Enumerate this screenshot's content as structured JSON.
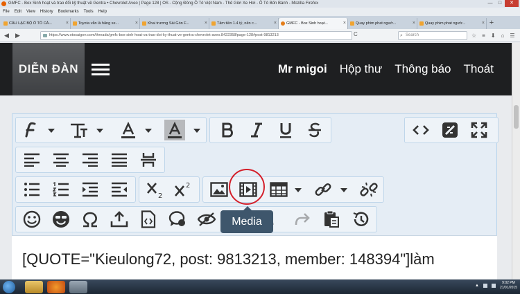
{
  "window": {
    "title": "GMFC - Box Sinh hoạt và trao đổi kỹ thuật về Gentra • Chevrolet Aveo | Page 128 | OS - Cộng Đồng Ô Tô Việt Nam - Thế Giới Xe Hơi - Ô Tô Bốn Bánh - Mozilla Firefox",
    "controls": {
      "minimize": "—",
      "maximize": "□",
      "close": "✕"
    }
  },
  "menubar": [
    "File",
    "Edit",
    "View",
    "History",
    "Bookmarks",
    "Tools",
    "Help"
  ],
  "tabs": [
    {
      "label": "CÂU LẠC BỘ Ô TÔ CÁ...",
      "active": false
    },
    {
      "label": "Toyota vẫn là hãng xe...",
      "active": false
    },
    {
      "label": "Khai trương Sài Gòn F...",
      "active": false
    },
    {
      "label": "Tâm tiền 1.4 tỷ, nên c...",
      "active": false
    },
    {
      "label": "GMFC - Box Sinh hoạt...",
      "active": true
    },
    {
      "label": "Quay phim phat ngườ...",
      "active": false
    },
    {
      "label": "Quay phim phat ngườ...",
      "active": false
    }
  ],
  "newtab": "+",
  "tab_close": "×",
  "navbar": {
    "url": "https://www.otosaigon.com/threads/gmfc-box-sinh-hoat-va-trao-doi-ky-thuat-ve-gentra-chevrolet-aveo.8422358/page-128#post-9813213",
    "search_placeholder": "Search",
    "back": "◀",
    "forward": "▶",
    "reload": "C"
  },
  "site": {
    "logo": "DIỄN ĐÀN",
    "nav": {
      "user": "Mr migoi",
      "inbox": "Hộp thư",
      "alerts": "Thông báo",
      "logout": "Thoát"
    }
  },
  "tooltip": "Media",
  "editor_text": "[QUOTE=\"Kieulong72, post: 9813213, member: 148394\"]làm",
  "taskbar": {
    "clock_time": "9:02 PM",
    "clock_date": "21/01/2015"
  },
  "colors": {
    "header_bg": "#1e1f21",
    "toolbar_bg": "#e5edf5",
    "highlight": "#d41f2a",
    "tooltip_bg": "#3e566c"
  }
}
